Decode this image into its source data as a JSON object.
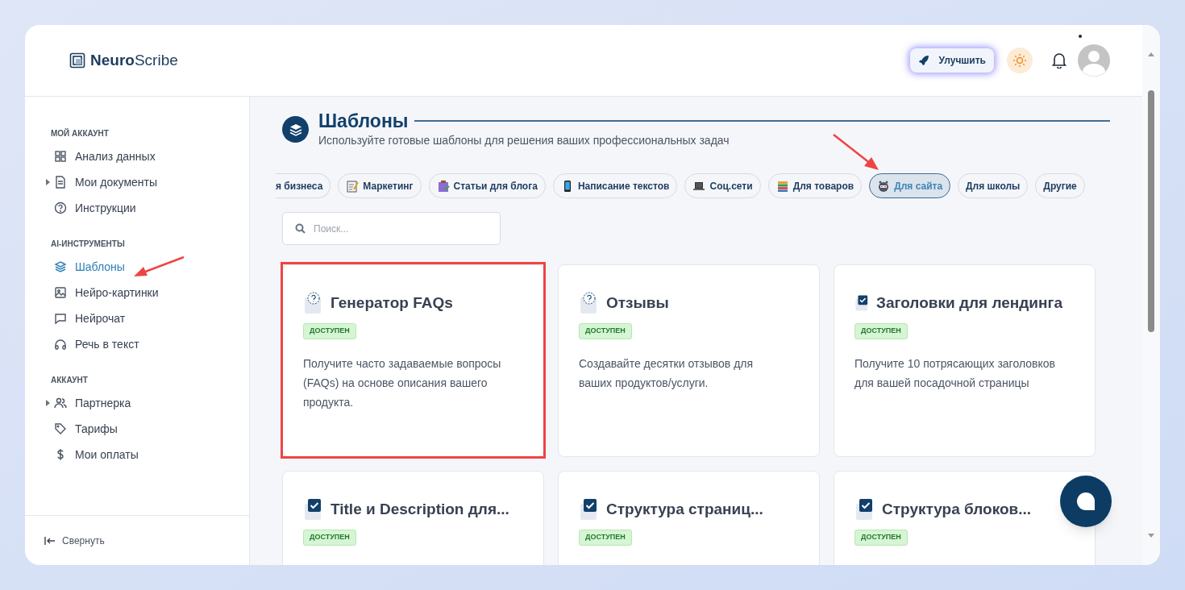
{
  "logo": {
    "bold": "Neuro",
    "light": "Scribe"
  },
  "header": {
    "upgrade_button": "Улучшить"
  },
  "sidebar": {
    "sections": [
      {
        "title": "МОЙ АККАУНТ",
        "items": [
          {
            "label": "Анализ данных",
            "expandable": false,
            "selected": false,
            "arrow": false
          },
          {
            "label": "Мои документы",
            "expandable": true,
            "selected": false,
            "arrow": false
          },
          {
            "label": "Инструкции",
            "expandable": false,
            "selected": false,
            "arrow": false
          }
        ]
      },
      {
        "title": "AI-ИНСТРУМЕНТЫ",
        "items": [
          {
            "label": "Шаблоны",
            "expandable": false,
            "selected": true,
            "arrow": true
          },
          {
            "label": "Нейро-картинки",
            "expandable": false,
            "selected": false,
            "arrow": false
          },
          {
            "label": "Нейрочат",
            "expandable": false,
            "selected": false,
            "arrow": false
          },
          {
            "label": "Речь в текст",
            "expandable": false,
            "selected": false,
            "arrow": false
          }
        ]
      },
      {
        "title": "АККАУНТ",
        "items": [
          {
            "label": "Партнерка",
            "expandable": true,
            "selected": false,
            "arrow": false
          },
          {
            "label": "Тарифы",
            "expandable": false,
            "selected": false,
            "arrow": false
          },
          {
            "label": "Мои оплаты",
            "expandable": false,
            "selected": false,
            "arrow": false
          }
        ]
      }
    ],
    "collapse": "Свернуть"
  },
  "page": {
    "title": "Шаблоны",
    "subtitle": "Используйте готовые шаблоны для решения ваших профессиональных задач"
  },
  "categories": [
    {
      "label": "я бизнеса",
      "selected": false,
      "arrow": false
    },
    {
      "label": "Маркетинг",
      "selected": false,
      "arrow": false
    },
    {
      "label": "Статьи для блога",
      "selected": false,
      "arrow": false
    },
    {
      "label": "Написание текстов",
      "selected": false,
      "arrow": false
    },
    {
      "label": "Соц.сети",
      "selected": false,
      "arrow": false
    },
    {
      "label": "Для товаров",
      "selected": false,
      "arrow": false
    },
    {
      "label": "Для сайта",
      "selected": true,
      "arrow": true
    },
    {
      "label": "Для школы",
      "selected": false,
      "arrow": false
    },
    {
      "label": "Другие",
      "selected": false,
      "arrow": false
    }
  ],
  "search": {
    "placeholder": "Поиск..."
  },
  "cards": [
    {
      "kind": "question",
      "title": "Генератор FAQs",
      "badge": "ДОСТУПЕН",
      "description": "Получите часто задаваемые вопросы (FAQs) на основе описания вашего продукта.",
      "highlighted": true
    },
    {
      "kind": "question",
      "title": "Отзывы",
      "badge": "ДОСТУПЕН",
      "description": "Создавайте десятки отзывов для ваших продуктов/услуги.",
      "highlighted": false
    },
    {
      "kind": "check",
      "title": "Заголовки для лендинга",
      "badge": "ДОСТУПЕН",
      "description": "Получите 10 потрясающих заголовков для вашей посадочной страницы",
      "highlighted": false
    },
    {
      "kind": "check",
      "title": "Title и Description для...",
      "badge": "ДОСТУПЕН",
      "highlighted": false
    },
    {
      "kind": "check",
      "title": "Структура страниц...",
      "badge": "ДОСТУПЕН",
      "highlighted": false
    },
    {
      "kind": "check",
      "title": "Структура блоков...",
      "badge": "ДОСТУПЕН",
      "highlighted": false
    }
  ]
}
